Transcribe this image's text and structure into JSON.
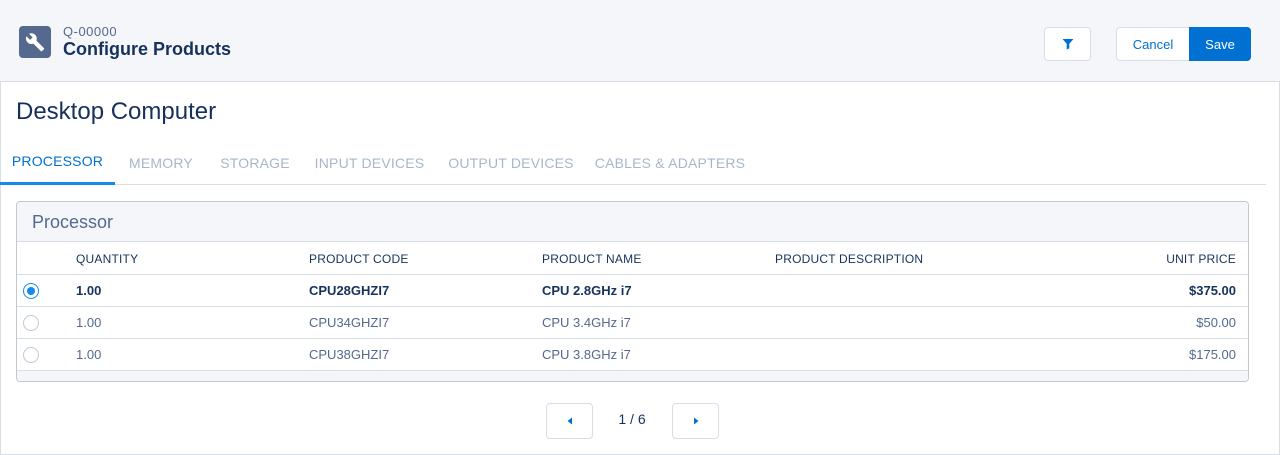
{
  "header": {
    "record_id": "Q-00000",
    "title": "Configure Products",
    "icon": "wrench-icon",
    "filter_icon": "filter-icon",
    "cancel_label": "Cancel",
    "save_label": "Save"
  },
  "section": {
    "title": "Desktop Computer"
  },
  "tabs": [
    {
      "label": "PROCESSOR",
      "active": true
    },
    {
      "label": "MEMORY",
      "active": false
    },
    {
      "label": "STORAGE",
      "active": false
    },
    {
      "label": "INPUT DEVICES",
      "active": false
    },
    {
      "label": "OUTPUT DEVICES",
      "active": false
    },
    {
      "label": "CABLES & ADAPTERS",
      "active": false
    }
  ],
  "card": {
    "title": "Processor",
    "columns": [
      "QUANTITY",
      "PRODUCT CODE",
      "PRODUCT NAME",
      "PRODUCT DESCRIPTION",
      "UNIT PRICE"
    ],
    "rows": [
      {
        "selected": true,
        "quantity": "1.00",
        "code": "CPU28GHZI7",
        "name": "CPU 2.8GHz i7",
        "description": "",
        "price": "$375.00"
      },
      {
        "selected": false,
        "quantity": "1.00",
        "code": "CPU34GHZI7",
        "name": "CPU 3.4GHz i7",
        "description": "",
        "price": "$50.00"
      },
      {
        "selected": false,
        "quantity": "1.00",
        "code": "CPU38GHZI7",
        "name": "CPU 3.8GHz i7",
        "description": "",
        "price": "$175.00"
      }
    ]
  },
  "pager": {
    "text": "1 / 6",
    "prev_icon": "caret-left-icon",
    "next_icon": "caret-right-icon"
  },
  "colors": {
    "brand": "#0070d2",
    "active_tab": "#1589ee",
    "text_dark": "#16325c",
    "text_muted": "#54698d"
  }
}
